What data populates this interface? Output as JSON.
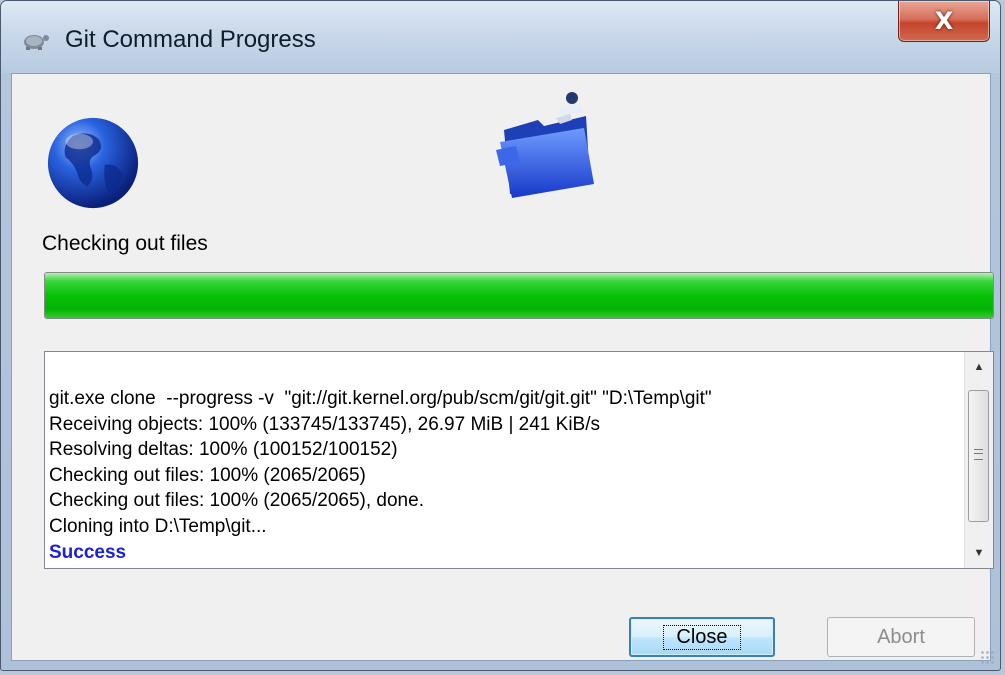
{
  "window": {
    "title": "Git Command Progress",
    "close_glyph": "X",
    "title_icon": "tortoisegit-icon"
  },
  "header": {
    "left_icon": "globe-icon",
    "center_icon": "folder-icon",
    "status_label": "Checking out files"
  },
  "progress": {
    "percent": 100,
    "fill_color": "#06c106"
  },
  "log": {
    "lines": [
      "git.exe clone  --progress -v  \"git://git.kernel.org/pub/scm/git/git.git\" \"D:\\Temp\\git\"",
      "Receiving objects: 100% (133745/133745), 26.97 MiB | 241 KiB/s",
      "Resolving deltas: 100% (100152/100152)",
      "Checking out files: 100% (2065/2065)",
      "Checking out files: 100% (2065/2065), done.",
      "Cloning into D:\\Temp\\git...",
      "Success"
    ],
    "success_color": "#1a22d8"
  },
  "buttons": {
    "close_label": "Close",
    "abort_label": "Abort"
  }
}
